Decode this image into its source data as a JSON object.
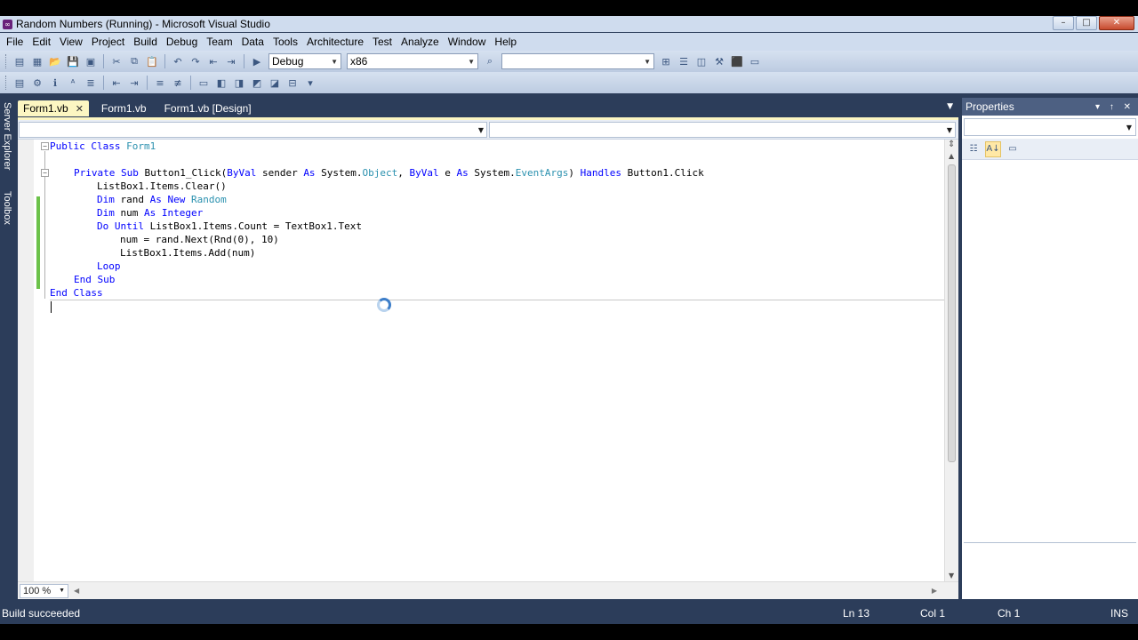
{
  "window": {
    "title": "Random Numbers (Running) - Microsoft Visual Studio",
    "controls": {
      "minimize": "–",
      "maximize": "□",
      "close": "✕"
    }
  },
  "menu": [
    "File",
    "Edit",
    "View",
    "Project",
    "Build",
    "Debug",
    "Team",
    "Data",
    "Tools",
    "Architecture",
    "Test",
    "Analyze",
    "Window",
    "Help"
  ],
  "toolbar": {
    "config": "Debug",
    "platform": "x86",
    "find": ""
  },
  "side_tabs": {
    "server_explorer": "Server Explorer",
    "toolbox": "Toolbox"
  },
  "tabs": [
    {
      "label": "Form1.vb",
      "active": true,
      "close": "✕"
    },
    {
      "label": "Form1.vb",
      "active": false
    },
    {
      "label": "Form1.vb [Design]",
      "active": false
    }
  ],
  "code": {
    "lines": {
      "l1": {
        "kw1": "Public Class ",
        "ty1": "Form1"
      },
      "l3": {
        "kw1": "Private Sub ",
        "t1": "Button1_Click(",
        "kw2": "ByVal",
        "t2": " sender ",
        "kw3": "As",
        "t3": " System.",
        "ty1": "Object",
        "t4": ", ",
        "kw4": "ByVal",
        "t5": " e ",
        "kw5": "As",
        "t6": " System.",
        "ty2": "EventArgs",
        "t7": ") ",
        "kw6": "Handles",
        "t8": " Button1.Click"
      },
      "l4": {
        "t1": "ListBox1.Items.Clear()"
      },
      "l5": {
        "kw1": "Dim",
        "t1": " rand ",
        "kw2": "As New",
        "t2": " ",
        "ty1": "Random"
      },
      "l6": {
        "kw1": "Dim",
        "t1": " num ",
        "kw2": "As Integer"
      },
      "l7": {
        "kw1": "Do Until",
        "t1": " ListBox1.Items.Count = TextBox1.Text"
      },
      "l8": {
        "t1": "num = rand.Next(Rnd(0), 10)"
      },
      "l9": {
        "t1": "ListBox1.Items.Add(num)"
      },
      "l10": {
        "kw1": "Loop"
      },
      "l11": {
        "kw1": "End Sub"
      },
      "l12": {
        "kw1": "End Class"
      }
    }
  },
  "zoom": "100 %",
  "properties": {
    "title": "Properties",
    "controls": "▾ ↑ ✕"
  },
  "status": {
    "message": "Build succeeded",
    "line": "Ln 13",
    "col": "Col 1",
    "ch": "Ch 1",
    "mode": "INS"
  },
  "colors": {
    "keyword": "#0000ff",
    "type": "#2b91af",
    "chrome": "#2c3d5a",
    "active_tab": "#fcf6c2",
    "change_bar": "#6cc24a"
  }
}
